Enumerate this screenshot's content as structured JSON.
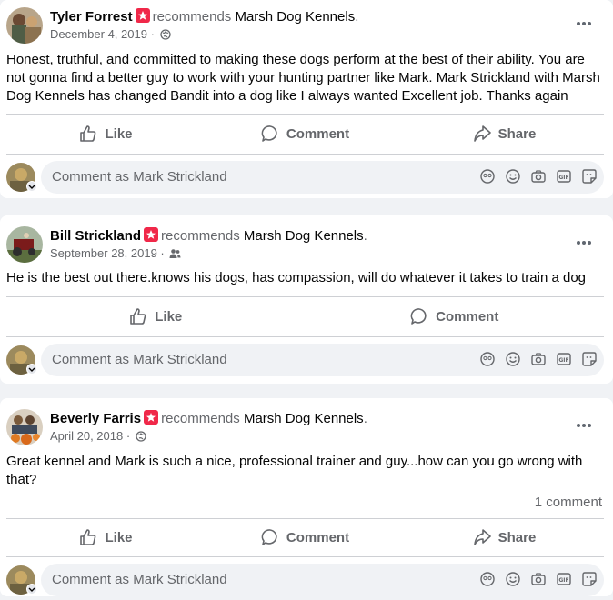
{
  "posts": [
    {
      "author": "Tyler Forrest",
      "recommends": "recommends",
      "page": "Marsh Dog Kennels",
      "page_suffix": ".",
      "date": "December 4, 2019",
      "privacy_icon": "globe-icon",
      "body": "Honest, truthful, and committed to making these dogs perform at the best of their ability. You are not gonna find a better guy to work with your hunting partner like Mark. Mark Strickland with Marsh Dog Kennels has changed Bandit into a dog like I always wanted Excellent job. Thanks again",
      "actions": {
        "like": "Like",
        "comment": "Comment",
        "share": "Share"
      },
      "comment_placeholder": "Comment as Mark Strickland"
    },
    {
      "author": "Bill Strickland",
      "recommends": "recommends",
      "page": "Marsh Dog Kennels",
      "page_suffix": ".",
      "date": "September 28, 2019",
      "privacy_icon": "friends-icon",
      "body": "He is the best out there.knows his dogs, has compassion, will do whatever it takes to train a dog",
      "actions": {
        "like": "Like",
        "comment": "Comment"
      },
      "comment_placeholder": "Comment as Mark Strickland"
    },
    {
      "author": "Beverly Farris",
      "recommends": "recommends",
      "page": "Marsh Dog Kennels",
      "page_suffix": ".",
      "date": "April 20, 2018",
      "body": "Great kennel and Mark is such a nice, professional trainer and guy...how can you go wrong with that?",
      "comment_count": "1 comment",
      "actions": {
        "like": "Like",
        "comment": "Comment",
        "share": "Share"
      },
      "comment_placeholder": "Comment as Mark Strickland"
    }
  ],
  "colors": {
    "background": "#f0f2f5",
    "card": "#ffffff",
    "secondary_text": "#65676b",
    "recommend_badge": "#f02849",
    "divider": "#ced0d4"
  }
}
